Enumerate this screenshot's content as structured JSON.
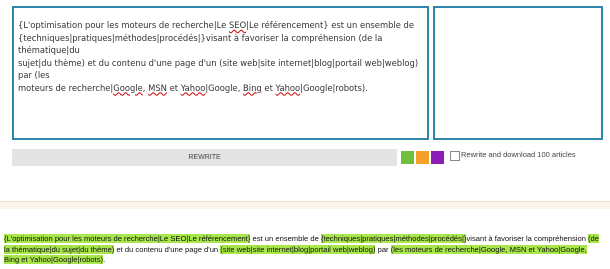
{
  "editor": {
    "line1_a": "{L'optimisation pour les moteurs de recherche|Le ",
    "line1_seo": "SEO",
    "line1_b": "|Le référencement} est un ensemble de",
    "line2": "{techniques|pratiques|méthodes|procédés|}visant à favoriser la compréhension (de la thématique|du",
    "line3": "sujet|du thème) et du contenu d'une page d'un (site web|site internet|blog|portail web|weblog) par (les",
    "line4_a": "moteurs de recherche|",
    "line4_google": "Google",
    "line4_b": ", ",
    "line4_msn": "MSN",
    "line4_c": " et ",
    "line4_yahoo": "Yahoo",
    "line4_d": "|Google, ",
    "line4_bing": "Bing",
    "line4_e": " et ",
    "line4_yahoo2": "Yahoo",
    "line4_f": "|Google|robots)."
  },
  "toolbar": {
    "rewrite_label": "REWRITE",
    "checkbox_label": "Rewrite and download 100 articles"
  },
  "colors": {
    "green": "#6fbf3d",
    "orange": "#f5a02a",
    "purple": "#8b1db8",
    "highlight": "#a8e64b",
    "border": "#2f86ad"
  },
  "result": {
    "h1": "{L'optimisation pour les moteurs de recherche|Le SEO|Le référencement}",
    "t1": " est un ensemble de ",
    "h2": "{techniques|pratiques|méthodes|procédés|}",
    "t2": "visant à favoriser la compréhension ",
    "h3": "(de la thématique|du sujet|du thème)",
    "t3": " et du contenu d'une page d'un ",
    "h4": "(site web|site internet|blog|portail web|weblog)",
    "t4": " par ",
    "h5": "(les moteurs de recherche|Google, MSN et Yahoo|Google, Bing et Yahoo|Google|robots)",
    "t5": "."
  }
}
